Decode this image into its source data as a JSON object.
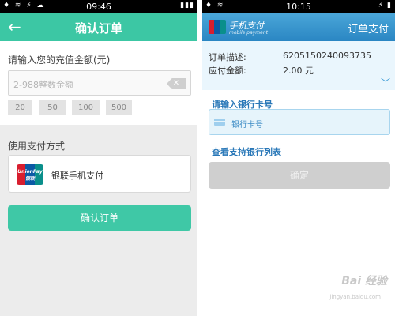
{
  "left": {
    "status_time": "09:46",
    "status_icons": "♦ ≋ ⚡ ☁",
    "status_right": "▮▮▮",
    "header": {
      "back_icon": "←",
      "title": "确认订单"
    },
    "amount_label": "请输入您的充值金额(元)",
    "amount_placeholder": "2-988整数金额",
    "quick_amounts": [
      "20",
      "50",
      "100",
      "500"
    ],
    "pay_method_label": "使用支付方式",
    "pay_method": {
      "logo_text": "UnionPay 银联",
      "name": "银联手机支付"
    },
    "confirm_label": "确认订单",
    "colors": {
      "accent": "#3cc7a4"
    }
  },
  "right": {
    "status_time": "10:15",
    "status_icons": "♦ ≋",
    "status_right": "⚡ ▮",
    "header": {
      "brand": "手机支付",
      "brand_sub": "mobile payment",
      "title": "订单支付"
    },
    "order": {
      "desc_label": "订单描述:",
      "desc_value": "6205150240093735",
      "amount_label": "应付金额:",
      "amount_value": "2.00 元"
    },
    "card_label": "请输入银行卡号",
    "card_placeholder": "银行卡号",
    "bank_list_link": "查看支持银行列表",
    "ok_label": "确定",
    "colors": {
      "accent": "#2a86c3"
    }
  },
  "watermark": {
    "text": "Bai 经验",
    "sub": "jingyan.baidu.com"
  }
}
